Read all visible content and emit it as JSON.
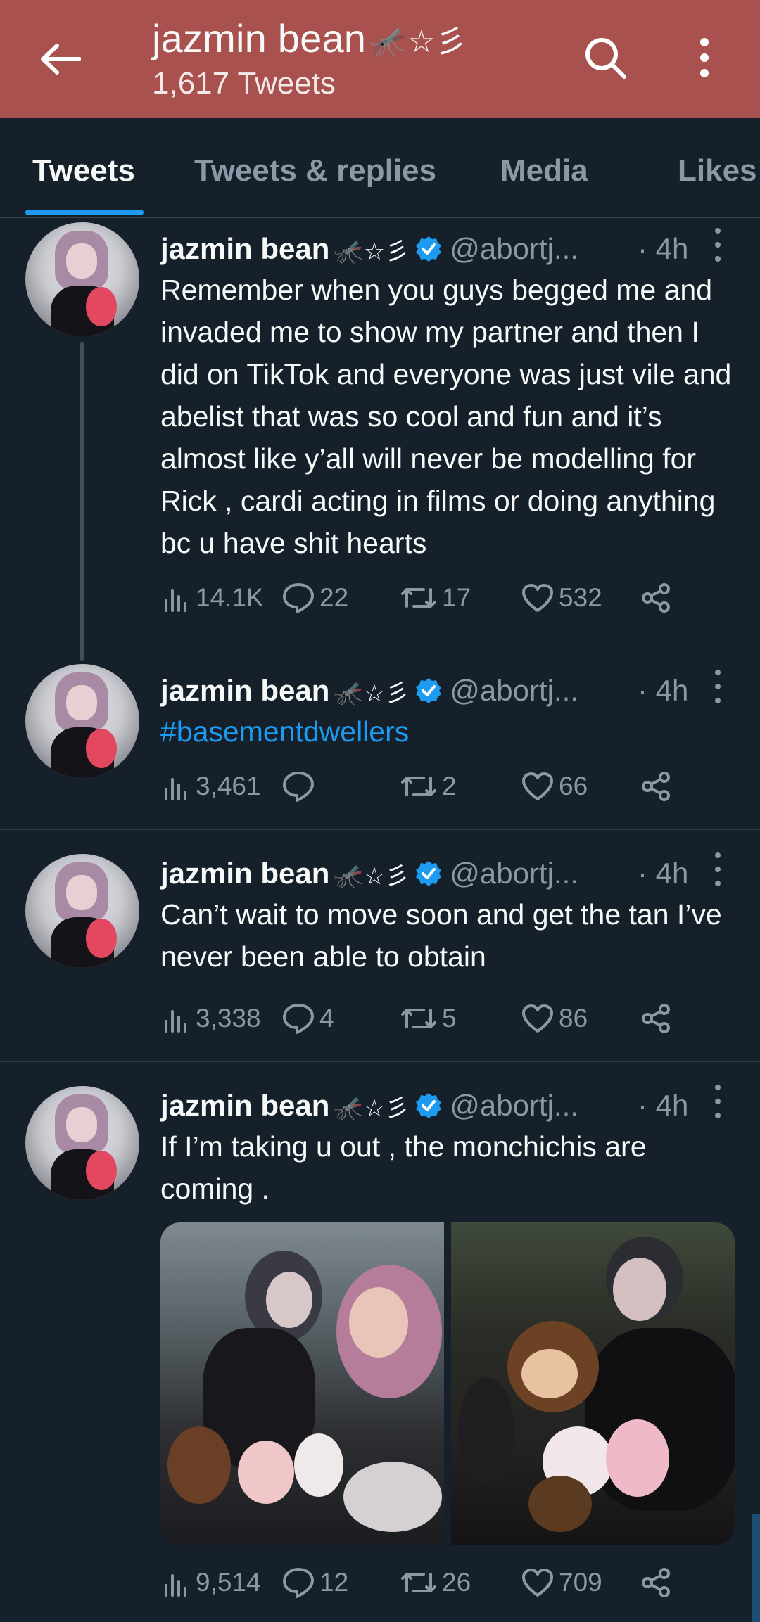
{
  "header": {
    "title": "jazmin bean",
    "title_emoji": "🦟☆彡",
    "subtitle": "1,617 Tweets",
    "background": "#a8514e",
    "icons": [
      "back-arrow-icon",
      "search-icon",
      "more-vertical-icon"
    ]
  },
  "tabs": [
    {
      "label": "Tweets",
      "active": true
    },
    {
      "label": "Tweets & replies",
      "active": false
    },
    {
      "label": "Media",
      "active": false
    },
    {
      "label": "Likes",
      "active": false
    }
  ],
  "tweets": [
    {
      "name": "jazmin bean",
      "name_emoji": "🦟☆彡",
      "handle": "@abortj...",
      "time": "· 4h",
      "text": "Remember when you guys begged me and invaded me to show my partner and then I did on TikTok and everyone was just vile and abelist that was so cool and fun and it’s almost like y’all will never be modelling for Rick , cardi acting in films or doing anything bc u have shit hearts",
      "views": "14.1K",
      "replies": "22",
      "retweets": "17",
      "likes": "532"
    },
    {
      "name": "jazmin bean",
      "name_emoji": "🦟☆彡",
      "handle": "@abortj...",
      "time": "· 4h",
      "text": "#basementdwellers",
      "views": "3,461",
      "replies": "",
      "retweets": "2",
      "likes": "66"
    },
    {
      "name": "jazmin bean",
      "name_emoji": "🦟☆彡",
      "handle": "@abortj...",
      "time": "· 4h",
      "text": "Can’t wait to move soon and get the tan I’ve never been able to obtain",
      "views": "3,338",
      "replies": "4",
      "retweets": "5",
      "likes": "86"
    },
    {
      "name": "jazmin bean",
      "name_emoji": "🦟☆彡",
      "handle": "@abortj...",
      "time": "· 4h",
      "text": "If I’m taking u out , the monchichis are coming .",
      "views": "9,514",
      "replies": "12",
      "retweets": "26",
      "likes": "709"
    }
  ],
  "colors": {
    "background": "#15202b",
    "accent": "#1d9bf0",
    "secondary_text": "#8b98a5"
  }
}
